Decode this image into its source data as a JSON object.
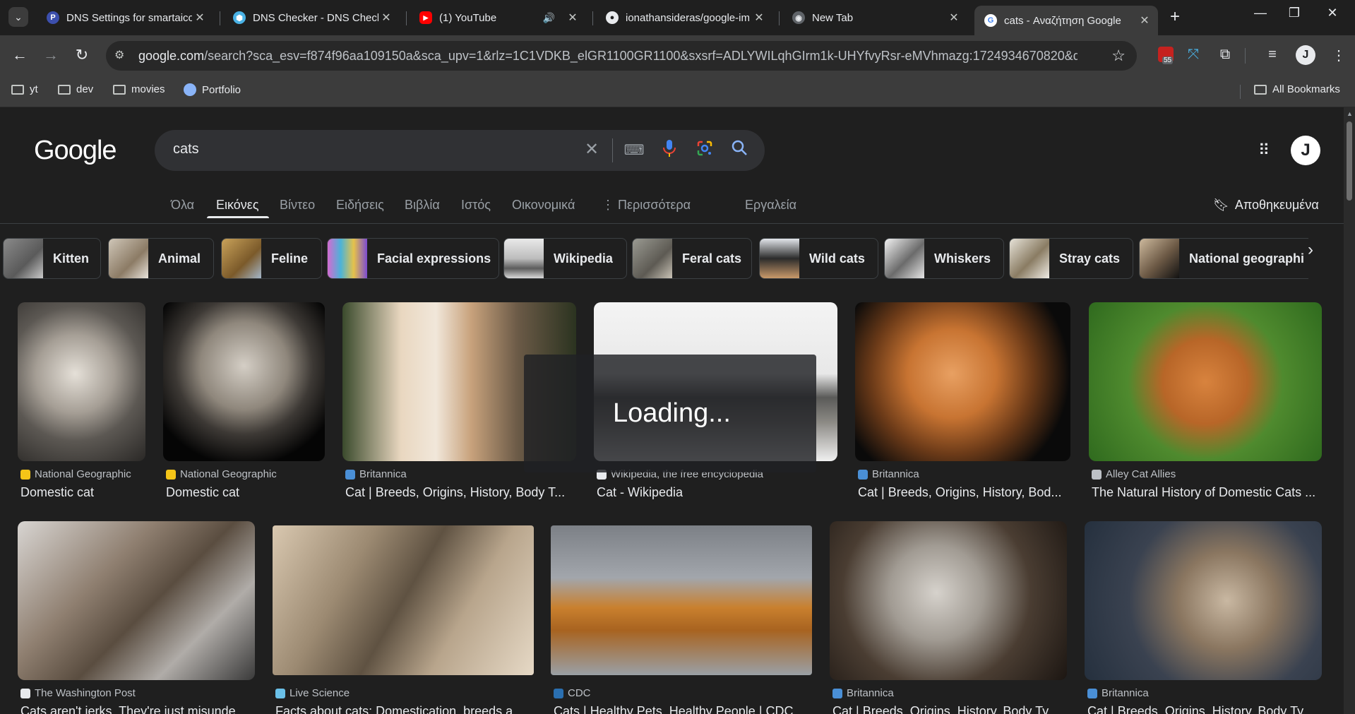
{
  "browser": {
    "tabs": [
      {
        "title": "DNS Settings for smartaico",
        "favicon": "P",
        "color": "#3c4fad"
      },
      {
        "title": "DNS Checker - DNS Check",
        "favicon": "⬢",
        "color": "#4ab2e5"
      },
      {
        "title": "(1) YouTube",
        "favicon": "▶",
        "color": "#ff0000",
        "audio": "🔊"
      },
      {
        "title": "ionathansideras/google-im",
        "favicon": "●",
        "color": "#e8eaed"
      },
      {
        "title": "New Tab",
        "favicon": "◉",
        "color": "#e8eaed"
      },
      {
        "title": "cats - Αναζήτηση Google",
        "favicon": "G",
        "color": "#ffffff"
      }
    ],
    "close_glyph": "✕",
    "new_tab": "+",
    "url_domain": "google.com",
    "url_path": "/search?sca_esv=f874f96aa109150a&sca_upv=1&rlz=1C1VDKB_elGR1100GR1100&sxsrf=ADLYWILqhGIrm1k-UHYfvyRsr-eMVhmazg:1724934670820&q=cats&ud...",
    "ext_badge": "55",
    "bookmarks": [
      {
        "label": "yt"
      },
      {
        "label": "dev"
      },
      {
        "label": "movies"
      },
      {
        "label": "Portfolio"
      }
    ],
    "all_bookmarks": "All Bookmarks"
  },
  "google": {
    "logo": "Google",
    "query": "cats",
    "nav_tabs": [
      "Όλα",
      "Εικόνες",
      "Βίντεο",
      "Ειδήσεις",
      "Βιβλία",
      "Ιστός",
      "Οικονομικά",
      "⋮ Περισσότερα"
    ],
    "tools": "Εργαλεία",
    "saved": "Αποθηκευμένα",
    "chips": [
      "Kitten",
      "Animal",
      "Feline",
      "Facial expressions",
      "Wikipedia",
      "Feral cats",
      "Wild cats",
      "Whiskers",
      "Stray cats",
      "National geographi"
    ],
    "loading": "Loading...",
    "results_row1": [
      {
        "source": "National Geographic",
        "caption": "Domestic cat"
      },
      {
        "source": "National Geographic",
        "caption": "Domestic cat"
      },
      {
        "source": "Britannica",
        "caption": "Cat | Breeds, Origins, History, Body T..."
      },
      {
        "source": "Wikipedia, the free encyclopedia",
        "caption": "Cat - Wikipedia"
      },
      {
        "source": "Britannica",
        "caption": "Cat | Breeds, Origins, History, Bod..."
      },
      {
        "source": "Alley Cat Allies",
        "caption": "The Natural History of Domestic Cats ..."
      }
    ],
    "results_row2": [
      {
        "source": "The Washington Post",
        "caption": "Cats aren't jerks. They're just misunde..."
      },
      {
        "source": "Live Science",
        "caption": "Facts about cats: Domestication, breeds a..."
      },
      {
        "source": "CDC",
        "caption": "Cats | Healthy Pets, Healthy People | CDC"
      },
      {
        "source": "Britannica",
        "caption": "Cat | Breeds, Origins, History, Body Ty..."
      },
      {
        "source": "Britannica",
        "caption": "Cat | Breeds, Origins, History, Body Ty..."
      }
    ]
  },
  "colors": {
    "chrome_bg": "#1f1f1f",
    "toolbar_bg": "#3c3c3c",
    "page_bg": "#1f1f1f",
    "accent_mic_blue": "#4285f4",
    "accent_mic_red": "#ea4335"
  }
}
